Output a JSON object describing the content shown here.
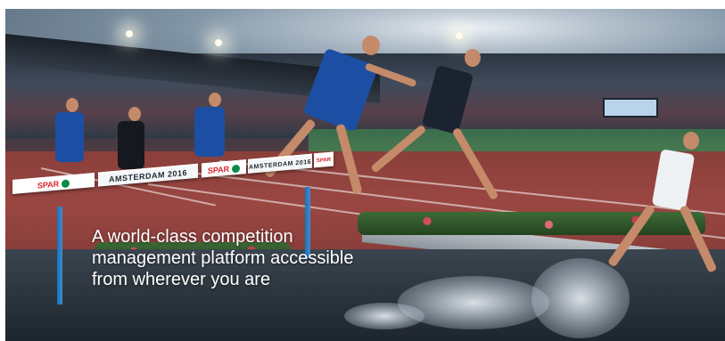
{
  "hero": {
    "headline_line1": "A world-class competition",
    "headline_line2": "management platform accessible",
    "headline_line3": "from wherever you are",
    "barrier_text_1": "AMSTERDAM 2016",
    "barrier_text_2": "AMSTERDAM 2016",
    "sponsor_1": "SPAR",
    "sponsor_2": "SPAR",
    "sponsor_3": "SPAR",
    "colors": {
      "track": "#9a4742",
      "barrier_leg": "#1f6fb6",
      "spar_red": "#d8232a",
      "spar_green": "#0b8c46",
      "italy_blue": "#1c4fa3",
      "headline": "#ffffff"
    }
  }
}
